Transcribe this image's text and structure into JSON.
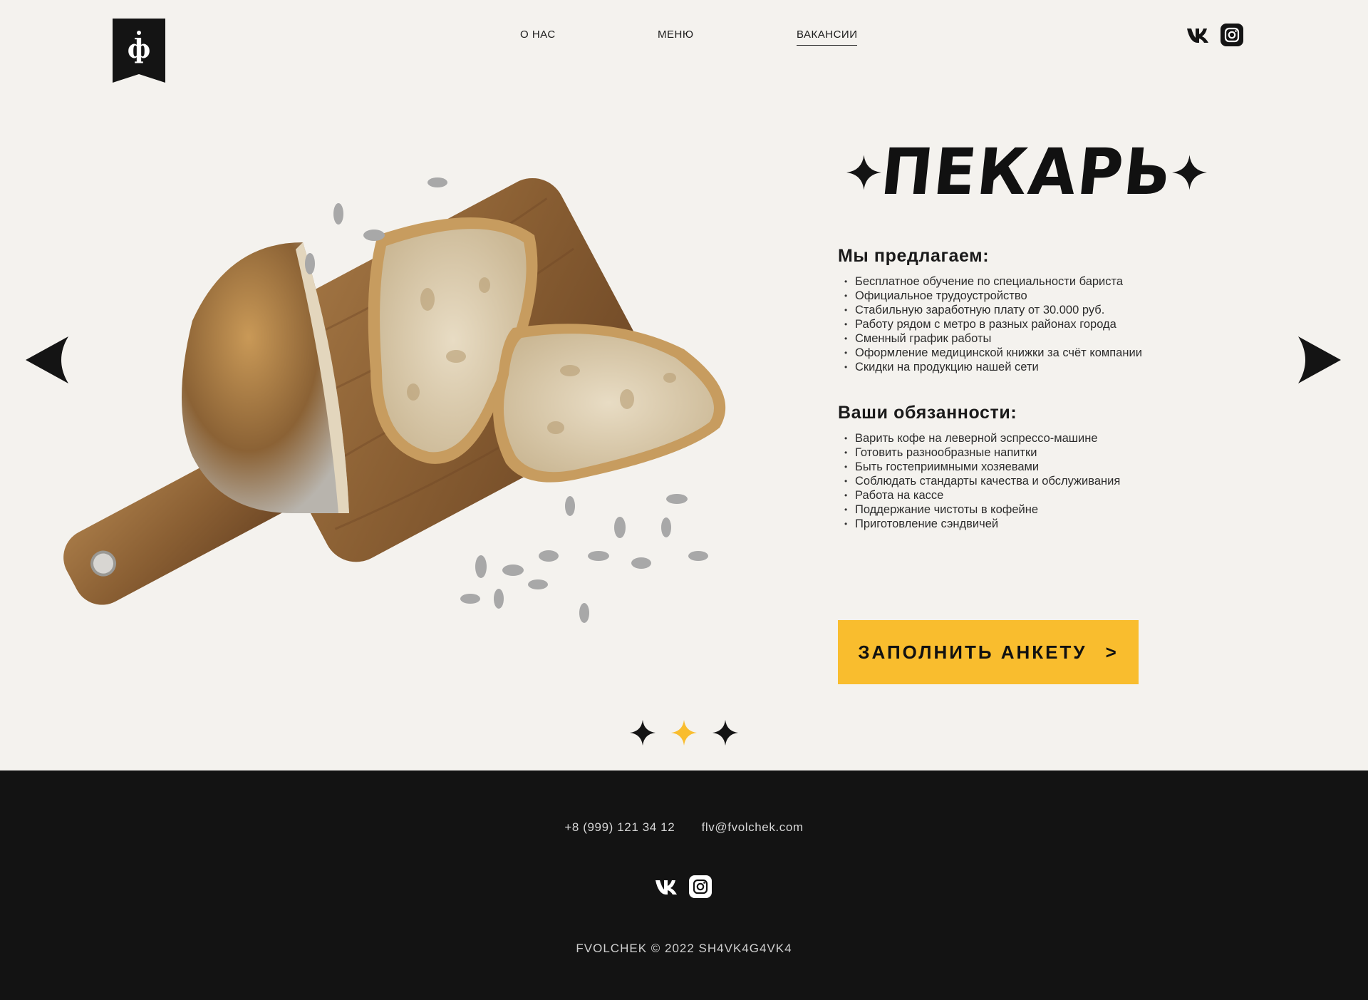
{
  "header": {
    "nav": [
      {
        "label": "О НАС"
      },
      {
        "label": "МЕНЮ"
      },
      {
        "label": "ВАКАНСИИ",
        "active": true
      }
    ],
    "logo_letter": "ф",
    "social_icons": [
      "vk-icon",
      "instagram-icon"
    ]
  },
  "vacancy": {
    "title": "ПЕКАРЬ",
    "offer_heading": "Мы предлагаем:",
    "offer_items": [
      "Бесплатное обучение по специальности бариста",
      "Официальное трудоустройство",
      "Стабильную заработную плату от 30.000 руб.",
      "Работу рядом с метро в разных районах города",
      "Сменный график работы",
      "Оформление медицинской книжки за счёт компании",
      "Скидки на продукцию нашей сети"
    ],
    "duties_heading": "Ваши обязанности:",
    "duties_items": [
      "Варить кофе на леверной эспрессо-машине",
      "Готовить разнообразные напитки",
      "Быть гостеприимными хозяевами",
      "Соблюдать стандарты качества и обслуживания",
      "Работа на кассе",
      "Поддержание чистоты в кофейне",
      "Приготовление сэндвичей"
    ],
    "cta_label": "ЗАПОЛНИТЬ АНКЕТУ",
    "cta_arrow": ">"
  },
  "slider": {
    "active_index": 1,
    "count": 3
  },
  "footer": {
    "phone": "+8 (999) 121 34 12",
    "email": "flv@fvolchek.com",
    "copyright": "FVOLCHEK © 2022 SH4VK4G4VK4"
  },
  "colors": {
    "background": "#f4f2ee",
    "accent": "#f9bd2e",
    "footer_bg": "#131313",
    "text": "#1a1a1a"
  }
}
